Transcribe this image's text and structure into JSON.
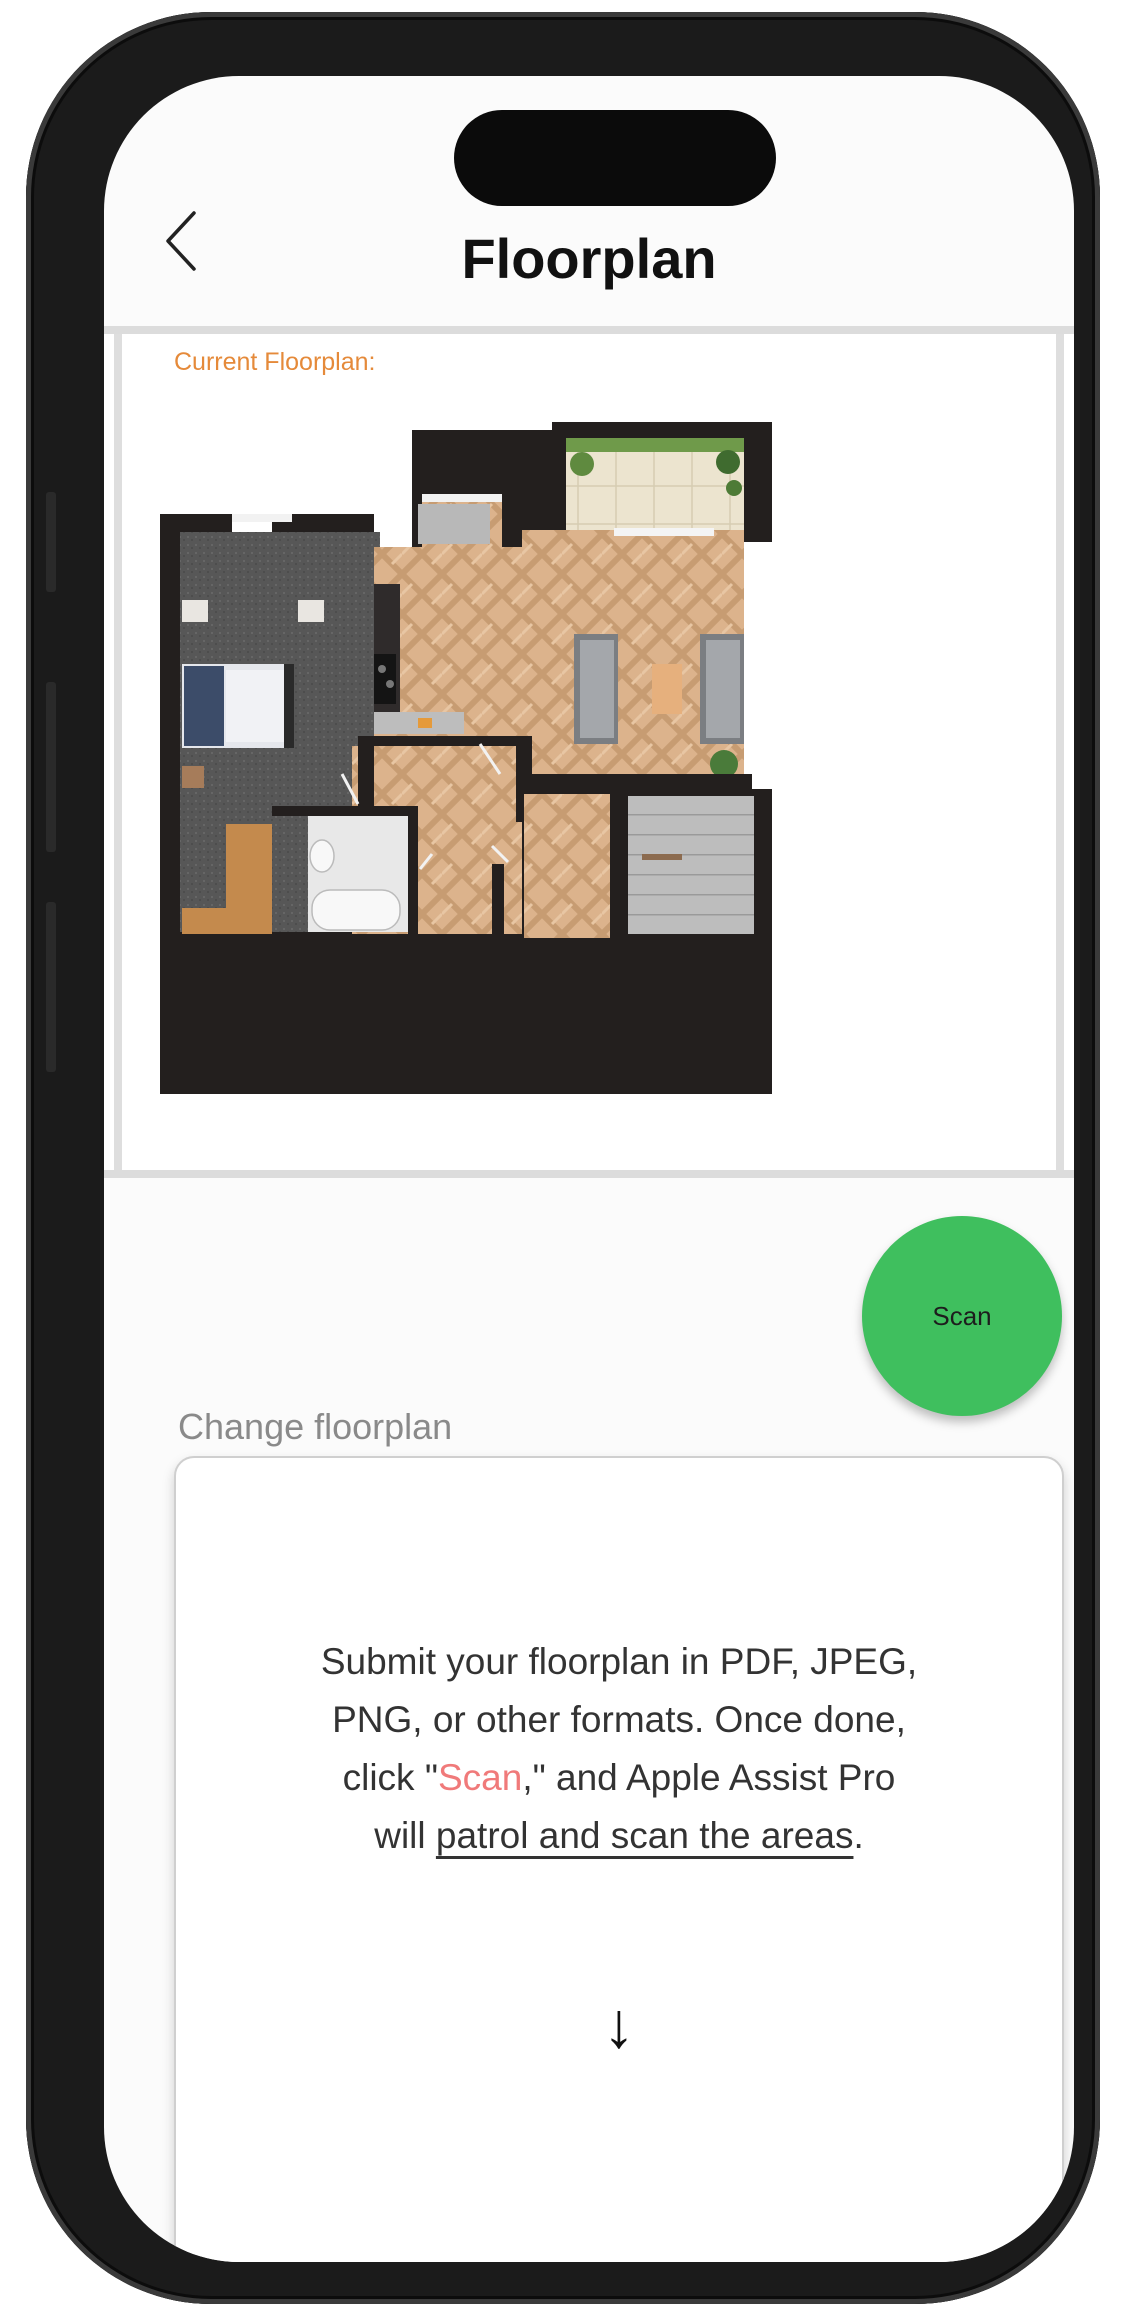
{
  "header": {
    "title": "Floorplan",
    "back_icon": "chevron-left-icon"
  },
  "floorplan": {
    "label": "Current Floorplan:"
  },
  "scan_button": {
    "label": "Scan"
  },
  "upload": {
    "heading": "Change floorplan",
    "line1": "Submit your floorplan in PDF, JPEG,",
    "line2": "PNG, or other formats. Once done,",
    "line3_prefix": "click \"",
    "line3_scan": "Scan",
    "line3_suffix": ",\" and Apple Assist Pro",
    "line4_prefix": "will ",
    "line4_link": "patrol and scan the areas",
    "line4_suffix": ".",
    "arrow": "↓"
  },
  "colors": {
    "accent_orange": "#e58a3a",
    "scan_green": "#3fbf5e",
    "scan_highlight": "#f07a7a",
    "wall": "#231f1e",
    "wood": "#d9ae84",
    "carpet": "#5a5a5a"
  }
}
